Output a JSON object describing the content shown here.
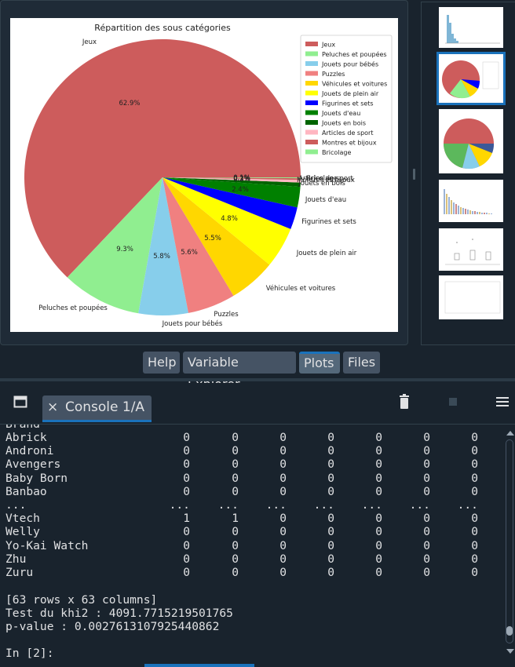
{
  "plots": {
    "chart_data": {
      "type": "pie",
      "title": "Répartition des sous catégories",
      "slices": [
        {
          "label": "Jeux",
          "value": 62.9,
          "color": "#cd5c5c"
        },
        {
          "label": "Peluches et poupées",
          "value": 9.3,
          "color": "#90ee90"
        },
        {
          "label": "Jouets pour bébés",
          "value": 5.8,
          "color": "#87ceeb"
        },
        {
          "label": "Puzzles",
          "value": 5.6,
          "color": "#f08080"
        },
        {
          "label": "Véhicules et voitures",
          "value": 5.5,
          "color": "#ffd700"
        },
        {
          "label": "Jouets de plein air",
          "value": 4.8,
          "color": "#ffff00"
        },
        {
          "label": "Figurines et sets",
          "value": 2.6,
          "color": "#0000ff"
        },
        {
          "label": "Jouets d'eau",
          "value": 2.4,
          "color": "#008000"
        },
        {
          "label": "Jouets en bois",
          "value": 0.5,
          "color": "#006400"
        },
        {
          "label": "Articles de sport",
          "value": 0.3,
          "color": "#ffb6c1"
        },
        {
          "label": "Montres et bijoux",
          "value": 0.2,
          "color": "#cd5c5c"
        },
        {
          "label": "Bricolage",
          "value": 0.1,
          "color": "#90ee90"
        }
      ],
      "pct_labels": [
        "62.9%",
        "9.3%",
        "5.8%",
        "5.6%",
        "5.5%",
        "4.8%",
        "2.4%",
        "0.1%",
        "0.2%",
        "0.3%"
      ],
      "legend_position": "top-right"
    }
  },
  "tabs": [
    "Help",
    "Variable Explorer",
    "Plots",
    "Files"
  ],
  "console": {
    "tab_label": "Console 1/A",
    "close_glyph": "×",
    "partial_first_line": "Brand",
    "rows": [
      {
        "name": "Abrick",
        "values": [
          "0",
          "0",
          "0",
          "0",
          "0",
          "0",
          "0"
        ]
      },
      {
        "name": "Androni",
        "values": [
          "0",
          "0",
          "0",
          "0",
          "0",
          "0",
          "0"
        ]
      },
      {
        "name": "Avengers",
        "values": [
          "0",
          "0",
          "0",
          "0",
          "0",
          "0",
          "0"
        ]
      },
      {
        "name": "Baby Born",
        "values": [
          "0",
          "0",
          "0",
          "0",
          "0",
          "0",
          "0"
        ]
      },
      {
        "name": "Banbao",
        "values": [
          "0",
          "0",
          "0",
          "0",
          "0",
          "0",
          "0"
        ]
      },
      {
        "name": "...",
        "values": [
          "...",
          "...",
          "...",
          "...",
          "...",
          "...",
          "..."
        ]
      },
      {
        "name": "Vtech",
        "values": [
          "1",
          "1",
          "0",
          "0",
          "0",
          "0",
          "0"
        ]
      },
      {
        "name": "Welly",
        "values": [
          "0",
          "0",
          "0",
          "0",
          "0",
          "0",
          "0"
        ]
      },
      {
        "name": "Yo-Kai Watch",
        "values": [
          "0",
          "0",
          "0",
          "0",
          "0",
          "0",
          "0"
        ]
      },
      {
        "name": "Zhu",
        "values": [
          "0",
          "0",
          "0",
          "0",
          "0",
          "0",
          "0"
        ]
      },
      {
        "name": "Zuru",
        "values": [
          "0",
          "0",
          "0",
          "0",
          "0",
          "0",
          "0"
        ]
      }
    ],
    "summary": "[63 rows x 63 columns]",
    "khi2": "Test du khi2 : 4091.7715219501765",
    "pvalue": "p-value : 0.0027613107925440862",
    "prompt": "In [2]:"
  },
  "icons": {
    "pane_icon": "window-icon",
    "trash": "trash-icon",
    "stop": "stop-icon",
    "menu": "hamburger-menu-icon"
  }
}
